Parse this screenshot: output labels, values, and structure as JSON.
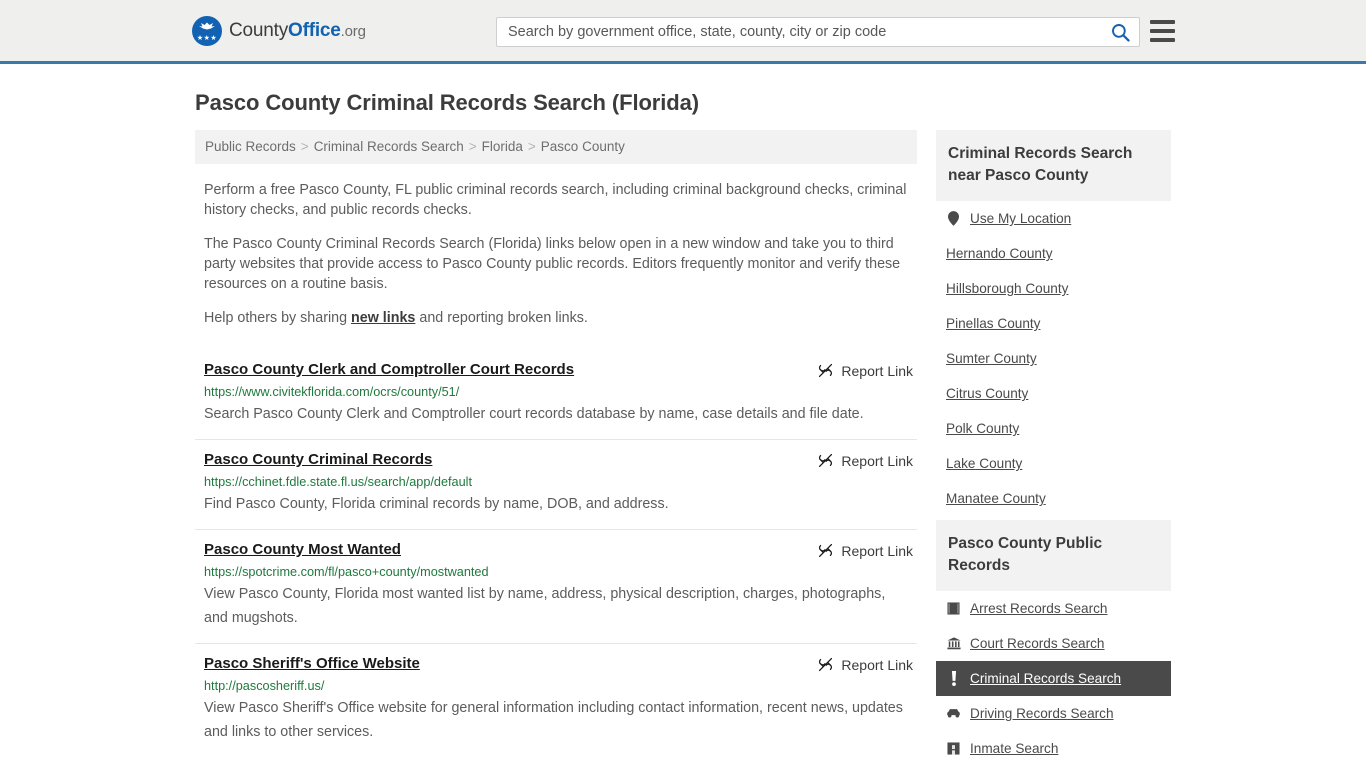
{
  "header": {
    "logo": {
      "part1": "County",
      "part2": "Office",
      "part3": ".org",
      "icon": "eagle-seal-icon",
      "stars": "★★★"
    },
    "search": {
      "placeholder": "Search by government office, state, county, city or zip code",
      "value": "",
      "button_icon": "search-icon"
    },
    "menu_icon": "hamburger-menu-icon",
    "accent_color": "#1262b3",
    "border_color": "#3b78ab"
  },
  "page": {
    "title": "Pasco County Criminal Records Search (Florida)"
  },
  "breadcrumb": {
    "items": [
      {
        "label": "Public Records"
      },
      {
        "label": "Criminal Records Search"
      },
      {
        "label": "Florida"
      },
      {
        "label": "Pasco County"
      }
    ],
    "separator": ">"
  },
  "intro": {
    "p1": "Perform a free Pasco County, FL public criminal records search, including criminal background checks, criminal history checks, and public records checks.",
    "p2": "The Pasco County Criminal Records Search (Florida) links below open in a new window and take you to third party websites that provide access to Pasco County public records. Editors frequently monitor and verify these resources on a routine basis.",
    "p3_before": "Help others by sharing ",
    "p3_link": "new links",
    "p3_after": " and reporting broken links."
  },
  "results": {
    "report_label": "Report Link",
    "report_icon": "broken-link-icon",
    "items": [
      {
        "title": "Pasco County Clerk and Comptroller Court Records",
        "url": "https://www.civitekflorida.com/ocrs/county/51/",
        "description": "Search Pasco County Clerk and Comptroller court records database by name, case details and file date."
      },
      {
        "title": "Pasco County Criminal Records",
        "url": "https://cchinet.fdle.state.fl.us/search/app/default",
        "description": "Find Pasco County, Florida criminal records by name, DOB, and address."
      },
      {
        "title": "Pasco County Most Wanted",
        "url": "https://spotcrime.com/fl/pasco+county/mostwanted",
        "description": "View Pasco County, Florida most wanted list by name, address, physical description, charges, photographs, and mugshots."
      },
      {
        "title": "Pasco Sheriff's Office Website",
        "url": "http://pascosheriff.us/",
        "description": "View Pasco Sheriff's Office website for general information including contact information, recent news, updates and links to other services."
      }
    ]
  },
  "sidebar": {
    "nearby": {
      "heading": "Criminal Records Search near Pasco County",
      "use_my_location": {
        "label": "Use My Location",
        "icon": "map-pin-icon"
      },
      "counties": [
        {
          "label": "Hernando County"
        },
        {
          "label": "Hillsborough County"
        },
        {
          "label": "Pinellas County"
        },
        {
          "label": "Sumter County"
        },
        {
          "label": "Citrus County"
        },
        {
          "label": "Polk County"
        },
        {
          "label": "Lake County"
        },
        {
          "label": "Manatee County"
        }
      ]
    },
    "public_records": {
      "heading": "Pasco County Public Records",
      "active_color": "#4a4a4a",
      "items": [
        {
          "label": "Arrest Records Search",
          "icon": "fingerprint-card-icon",
          "active": false
        },
        {
          "label": "Court Records Search",
          "icon": "courthouse-icon",
          "active": false
        },
        {
          "label": "Criminal Records Search",
          "icon": "exclamation-icon",
          "active": true
        },
        {
          "label": "Driving Records Search",
          "icon": "car-icon",
          "active": false
        },
        {
          "label": "Inmate Search",
          "icon": "jail-building-icon",
          "active": false
        }
      ]
    }
  }
}
